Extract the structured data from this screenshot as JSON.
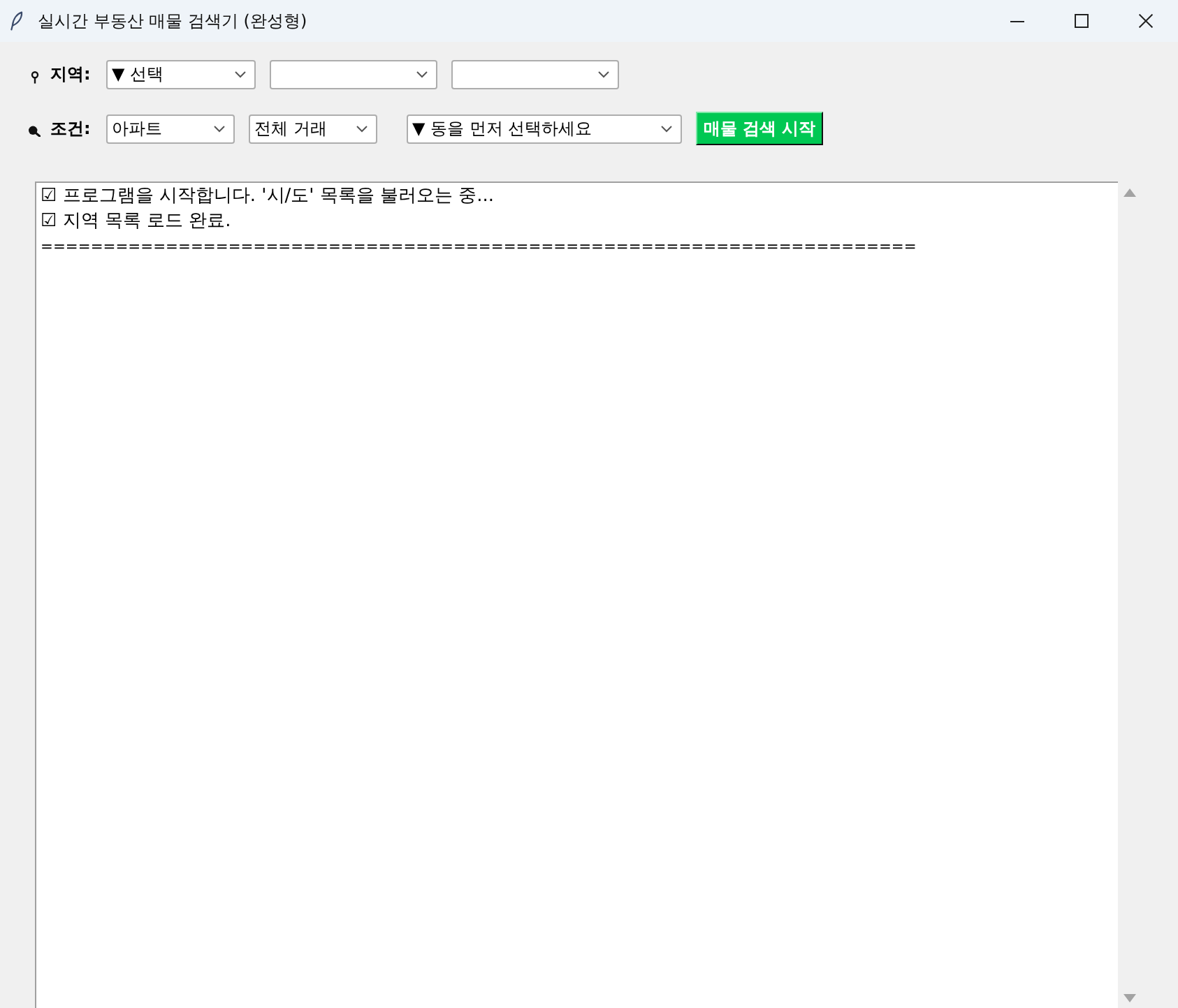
{
  "window": {
    "title": "실시간 부동산 매물 검색기 (완성형)"
  },
  "region_row": {
    "label": "지역:",
    "selects": [
      {
        "kind": "filled",
        "value": "▼ 선택"
      },
      {
        "kind": "blank"
      },
      {
        "kind": "blank"
      }
    ]
  },
  "condition_row": {
    "label": "조건:",
    "selects": [
      {
        "kind": "filled",
        "value": "아파트"
      },
      {
        "kind": "filled",
        "value": "전체 거래"
      },
      {
        "kind": "filled",
        "value": "▼ 동을 먼저 선택하세요"
      }
    ],
    "button": "매물 검색 시작"
  },
  "log": {
    "lines": [
      {
        "kind": "message",
        "text": "☑ 프로그램을 시작합니다. '시/도' 목록을 불러오는 중..."
      },
      {
        "kind": "message",
        "text": "☑ 지역 목록 로드 완료."
      },
      {
        "kind": "separator",
        "text": "======================================================================"
      }
    ]
  }
}
